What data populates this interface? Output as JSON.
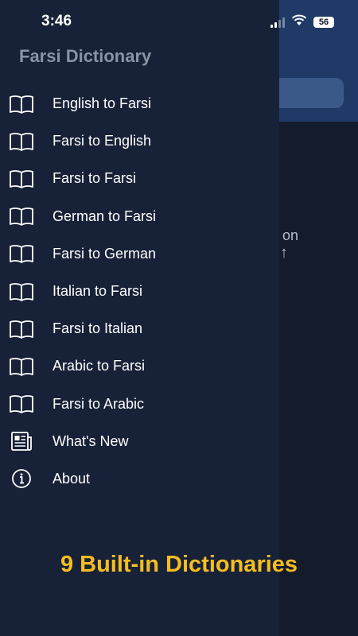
{
  "status_bar": {
    "time": "3:46",
    "battery": "56"
  },
  "background": {
    "hint_text": "on",
    "hint_arrow": "↑"
  },
  "drawer": {
    "title": "Farsi Dictionary",
    "items": [
      {
        "label": "English to Farsi",
        "icon": "book-icon"
      },
      {
        "label": "Farsi to English",
        "icon": "book-icon"
      },
      {
        "label": "Farsi to Farsi",
        "icon": "book-icon"
      },
      {
        "label": "German to Farsi",
        "icon": "book-icon"
      },
      {
        "label": "Farsi to German",
        "icon": "book-icon"
      },
      {
        "label": "Italian to Farsi",
        "icon": "book-icon"
      },
      {
        "label": "Farsi to Italian",
        "icon": "book-icon"
      },
      {
        "label": "Arabic to Farsi",
        "icon": "book-icon"
      },
      {
        "label": "Farsi to Arabic",
        "icon": "book-icon"
      },
      {
        "label": "What's New",
        "icon": "newspaper-icon"
      },
      {
        "label": "About",
        "icon": "info-icon"
      }
    ]
  },
  "promo": {
    "text": "9 Built-in Dictionaries"
  },
  "colors": {
    "drawer_bg": "#172137",
    "header_bg": "#1f3a66",
    "promo": "#f5bd1f"
  }
}
